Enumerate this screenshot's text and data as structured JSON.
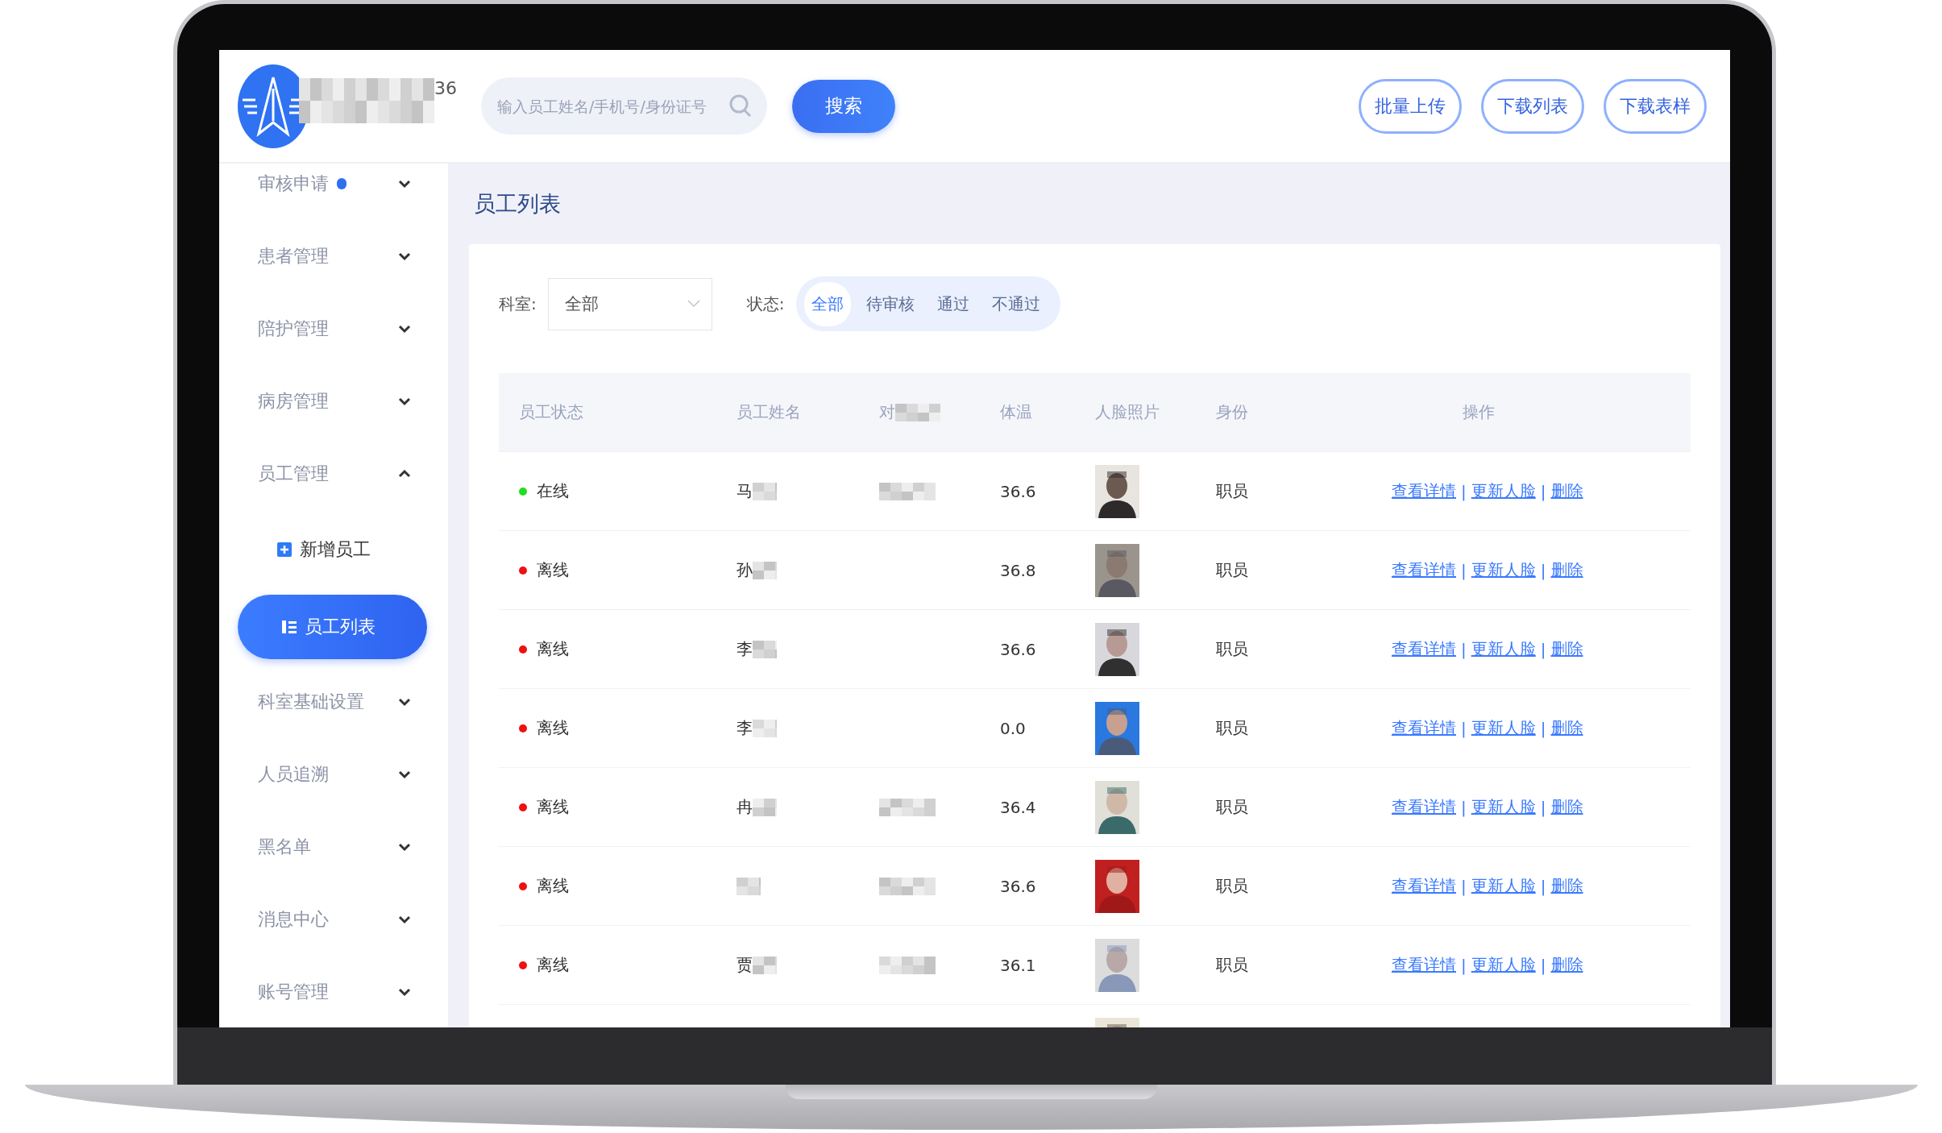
{
  "header": {
    "brand_redacted": true,
    "brand_suffix": "36",
    "search": {
      "placeholder": "输入员工姓名/手机号/身份证号"
    },
    "search_button": "搜索",
    "actions": [
      "批量上传",
      "下载列表",
      "下载表样"
    ]
  },
  "sidebar": {
    "items": [
      {
        "label": "审核申请",
        "dot": true,
        "expanded": false
      },
      {
        "label": "患者管理",
        "dot": false,
        "expanded": false
      },
      {
        "label": "陪护管理",
        "dot": false,
        "expanded": false
      },
      {
        "label": "病房管理",
        "dot": false,
        "expanded": false
      },
      {
        "label": "员工管理",
        "dot": false,
        "expanded": true,
        "children": [
          {
            "label": "新增员工",
            "kind": "add",
            "selected": false
          },
          {
            "label": "员工列表",
            "kind": "list",
            "selected": true
          }
        ]
      },
      {
        "label": "科室基础设置",
        "dot": false,
        "expanded": false
      },
      {
        "label": "人员追溯",
        "dot": false,
        "expanded": false
      },
      {
        "label": "黑名单",
        "dot": false,
        "expanded": false
      },
      {
        "label": "消息中心",
        "dot": false,
        "expanded": false
      },
      {
        "label": "账号管理",
        "dot": false,
        "expanded": false
      }
    ]
  },
  "page": {
    "title": "员工列表",
    "filters": {
      "department": {
        "label": "科室:",
        "value": "全部"
      },
      "status": {
        "label": "状态:",
        "options": [
          {
            "label": "全部",
            "selected": true
          },
          {
            "label": "待审核",
            "selected": false
          },
          {
            "label": "通过",
            "selected": false
          },
          {
            "label": "不通过",
            "selected": false
          }
        ]
      }
    },
    "table": {
      "columns": [
        {
          "label": "员工状态",
          "redacted": false
        },
        {
          "label": "员工姓名",
          "redacted": false
        },
        {
          "label": "对",
          "redacted": true
        },
        {
          "label": "体温",
          "redacted": false
        },
        {
          "label": "人脸照片",
          "redacted": false
        },
        {
          "label": "身份",
          "redacted": false
        },
        {
          "label": "操作",
          "redacted": false
        }
      ],
      "rows": [
        {
          "status": "在线",
          "color": "#22dd22",
          "name": "马",
          "name_redacted": true,
          "column_3_redacted": true,
          "temperature": "36.6",
          "photo": {
            "kind": "picture"
          },
          "role": "职员",
          "actions": [
            {
              "kind": "link",
              "label": "查看详情"
            },
            {
              "kind": "separator",
              "label": "|"
            },
            {
              "kind": "link",
              "label": "更新人脸"
            },
            {
              "kind": "separator",
              "label": "|"
            },
            {
              "kind": "link",
              "label": "删除"
            }
          ]
        },
        {
          "status": "离线",
          "color": "#ee1111",
          "name": "孙",
          "name_redacted": true,
          "column_3_redacted": false,
          "temperature": "36.8",
          "photo": {
            "kind": "picture"
          },
          "role": "职员",
          "actions": [
            {
              "kind": "link",
              "label": "查看详情"
            },
            {
              "kind": "separator",
              "label": "|"
            },
            {
              "kind": "link",
              "label": "更新人脸"
            },
            {
              "kind": "separator",
              "label": "|"
            },
            {
              "kind": "link",
              "label": "删除"
            }
          ]
        },
        {
          "status": "离线",
          "color": "#ee1111",
          "name": "李",
          "name_redacted": true,
          "column_3_redacted": false,
          "temperature": "36.6",
          "photo": {
            "kind": "picture"
          },
          "role": "职员",
          "actions": [
            {
              "kind": "link",
              "label": "查看详情"
            },
            {
              "kind": "separator",
              "label": "|"
            },
            {
              "kind": "link",
              "label": "更新人脸"
            },
            {
              "kind": "separator",
              "label": "|"
            },
            {
              "kind": "link",
              "label": "删除"
            }
          ]
        },
        {
          "status": "离线",
          "color": "#ee1111",
          "name": "李",
          "name_redacted": true,
          "column_3_redacted": false,
          "temperature": "0.0",
          "photo": {
            "kind": "picture"
          },
          "role": "职员",
          "actions": [
            {
              "kind": "link",
              "label": "查看详情"
            },
            {
              "kind": "separator",
              "label": "|"
            },
            {
              "kind": "link",
              "label": "更新人脸"
            },
            {
              "kind": "separator",
              "label": "|"
            },
            {
              "kind": "link",
              "label": "删除"
            }
          ]
        },
        {
          "status": "离线",
          "color": "#ee1111",
          "name": "冉",
          "name_redacted": true,
          "column_3_redacted": true,
          "temperature": "36.4",
          "photo": {
            "kind": "picture"
          },
          "role": "职员",
          "actions": [
            {
              "kind": "link",
              "label": "查看详情"
            },
            {
              "kind": "separator",
              "label": "|"
            },
            {
              "kind": "link",
              "label": "更新人脸"
            },
            {
              "kind": "separator",
              "label": "|"
            },
            {
              "kind": "link",
              "label": "删除"
            }
          ]
        },
        {
          "status": "离线",
          "color": "#ee1111",
          "name_redacted": true,
          "column_3_redacted": true,
          "temperature": "36.6",
          "photo": {
            "kind": "picture"
          },
          "role": "职员",
          "actions": [
            {
              "kind": "link",
              "label": "查看详情"
            },
            {
              "kind": "separator",
              "label": "|"
            },
            {
              "kind": "link",
              "label": "更新人脸"
            },
            {
              "kind": "separator",
              "label": "|"
            },
            {
              "kind": "link",
              "label": "删除"
            }
          ]
        },
        {
          "status": "离线",
          "color": "#ee1111",
          "name": "贾",
          "name_redacted": true,
          "column_3_redacted": true,
          "temperature": "36.1",
          "photo": {
            "kind": "picture"
          },
          "role": "职员",
          "actions": [
            {
              "kind": "link",
              "label": "查看详情"
            },
            {
              "kind": "separator",
              "label": "|"
            },
            {
              "kind": "link",
              "label": "更新人脸"
            },
            {
              "kind": "separator",
              "label": "|"
            },
            {
              "kind": "link",
              "label": "删除"
            }
          ]
        },
        {
          "photo": {
            "kind": "picture"
          }
        }
      ]
    }
  }
}
